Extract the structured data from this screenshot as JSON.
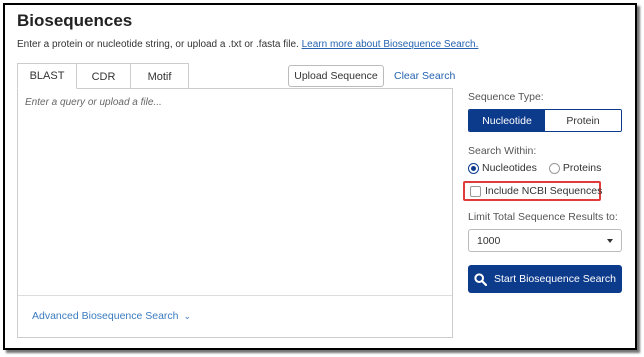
{
  "header": {
    "title": "Biosequences",
    "subtitle": "Enter a protein or nucleotide string, or upload a .txt or .fasta file.",
    "learn_more_link": "Learn more about Biosequence Search."
  },
  "tabs": [
    {
      "label": "BLAST",
      "active": true
    },
    {
      "label": "CDR",
      "active": false
    },
    {
      "label": "Motif",
      "active": false
    }
  ],
  "toolbar": {
    "upload_label": "Upload Sequence",
    "clear_label": "Clear Search"
  },
  "query": {
    "placeholder": "Enter a query or upload a file...",
    "value": "",
    "advanced_link": "Advanced Biosequence Search"
  },
  "sequence_type": {
    "label": "Sequence Type:",
    "options": [
      "Nucleotide",
      "Protein"
    ],
    "selected": "Nucleotide"
  },
  "search_within": {
    "label": "Search Within:",
    "options": [
      "Nucleotides",
      "Proteins"
    ],
    "selected": "Nucleotides"
  },
  "ncbi": {
    "label": "Include NCBI Sequences",
    "checked": false,
    "highlight_color": "#e03c3c"
  },
  "limit": {
    "label": "Limit Total Sequence Results to:",
    "value": "1000"
  },
  "start_button": {
    "label": "Start Biosequence Search",
    "icon": "search-icon"
  },
  "colors": {
    "primary": "#0d3b8c",
    "link": "#2563b0"
  }
}
